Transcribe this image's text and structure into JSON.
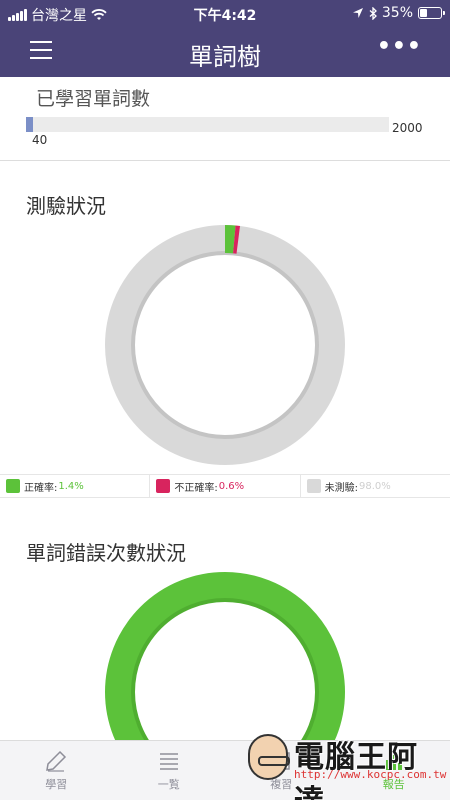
{
  "status_bar": {
    "carrier": "台灣之星",
    "time": "下午4:42",
    "battery": "35%",
    "battery_level": 0.35
  },
  "nav": {
    "title": "單詞樹",
    "more": "•••"
  },
  "learned": {
    "title": "已學習單詞數",
    "current": "40",
    "total": "2000",
    "progress_fraction": 0.02
  },
  "quiz": {
    "title": "測驗狀況",
    "correct_pct": 1.4,
    "incorrect_pct": 0.6,
    "untested_pct": 98.0,
    "legend": [
      {
        "label": "正確率:",
        "value": "1.4%",
        "color": "#5cc23a"
      },
      {
        "label": "不正確率:",
        "value": "0.6%",
        "color": "#d8245e"
      },
      {
        "label": "未測驗:",
        "value": "98.0%",
        "color": "#d9d9d9"
      }
    ]
  },
  "errors": {
    "title": "單詞錯誤次數狀況",
    "color": "#5cc23a"
  },
  "tabs": [
    {
      "label": "學習",
      "icon": "pen-icon"
    },
    {
      "label": "一覧",
      "icon": "list-icon"
    },
    {
      "label": "複習",
      "icon": "review-icon"
    },
    {
      "label": "報告",
      "icon": "report-icon"
    }
  ],
  "watermark": {
    "name": "電腦王阿達",
    "url": "http://www.kocpc.com.tw"
  }
}
